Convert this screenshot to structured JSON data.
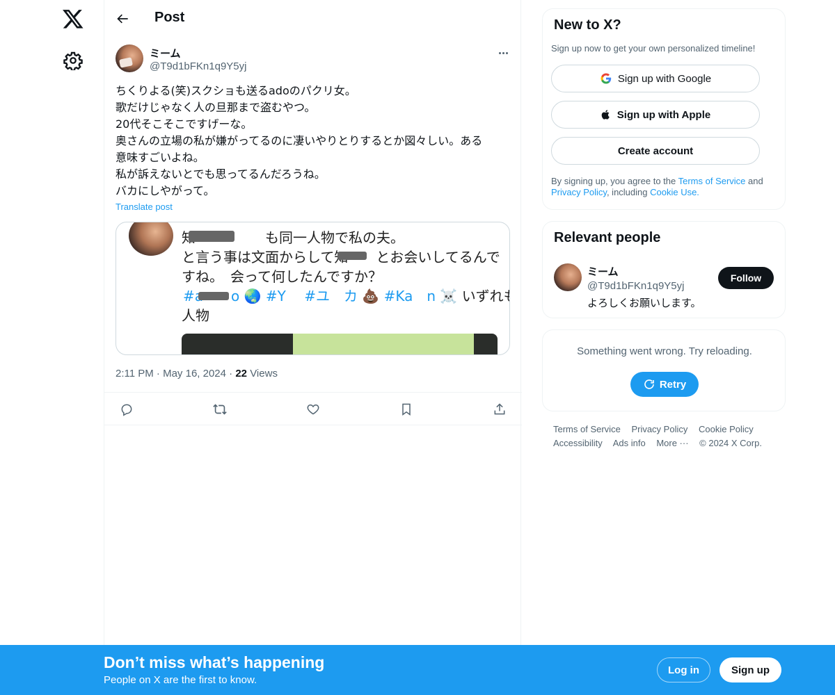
{
  "header": {
    "title": "Post"
  },
  "post": {
    "author_name": "ミーム",
    "author_handle": "@T9d1bFKn1q9Y5yj",
    "text": "ちくりよる(笑)スクショも送るadoのパクリ女。\n歌だけじゃなく人の旦那まで盗むやつ。\n20代そこそこですげーな。\n奥さんの立場の私が嫌がってるのに凄いやりとりするとか図々しい。ある\n意味すごいよね。\n私が訴えないとでも思ってるんだろうね。\nバカにしやがって。",
    "translate_label": "Translate post",
    "media": {
      "line1": "知　　　　　も同一人物で私の夫。",
      "line2": "と言う事は文面からして知　　とお会いしてるんで",
      "line3": "すね。　会って何したんですか？",
      "tag1": "#a　　o",
      "tag2": "#Y　",
      "tag3": "#ユ　カ",
      "tag4": "#Ka　n",
      "tags_tail": "いずれも同一",
      "line5": "人物",
      "emoji_globe": "🌏",
      "emoji_poop": "💩",
      "emoji_skull": "☠️"
    },
    "time": "2:11 PM",
    "date": "May 16, 2024",
    "views_count": "22",
    "views_label": "Views"
  },
  "sidebar": {
    "new_to_x": {
      "title": "New to X?",
      "subtitle": "Sign up now to get your own personalized timeline!",
      "google_label": "Sign up with Google",
      "apple_label": "Sign up with Apple",
      "create_label": "Create account",
      "legal_prefix": "By signing up, you agree to the ",
      "tos": "Terms of Service",
      "and": " and ",
      "privacy": "Privacy Policy",
      "including": ", including ",
      "cookie": "Cookie Use."
    },
    "relevant": {
      "title": "Relevant people",
      "name": "ミーム",
      "handle": "@T9d1bFKn1q9Y5yj",
      "bio": "よろしくお願いします。",
      "follow_label": "Follow"
    },
    "error": {
      "text": "Something went wrong. Try reloading.",
      "retry_label": "Retry"
    },
    "footer": {
      "tos": "Terms of Service",
      "privacy": "Privacy Policy",
      "cookie": "Cookie Policy",
      "accessibility": "Accessibility",
      "ads": "Ads info",
      "more": "More ···",
      "copyright": "© 2024 X Corp."
    }
  },
  "bottom_bar": {
    "title": "Don’t miss what’s happening",
    "subtitle": "People on X are the first to know.",
    "login_label": "Log in",
    "signup_label": "Sign up"
  },
  "colors": {
    "accent": "#1d9bf0",
    "text": "#0f1419",
    "secondary": "#536471",
    "border": "#eff3f4"
  }
}
